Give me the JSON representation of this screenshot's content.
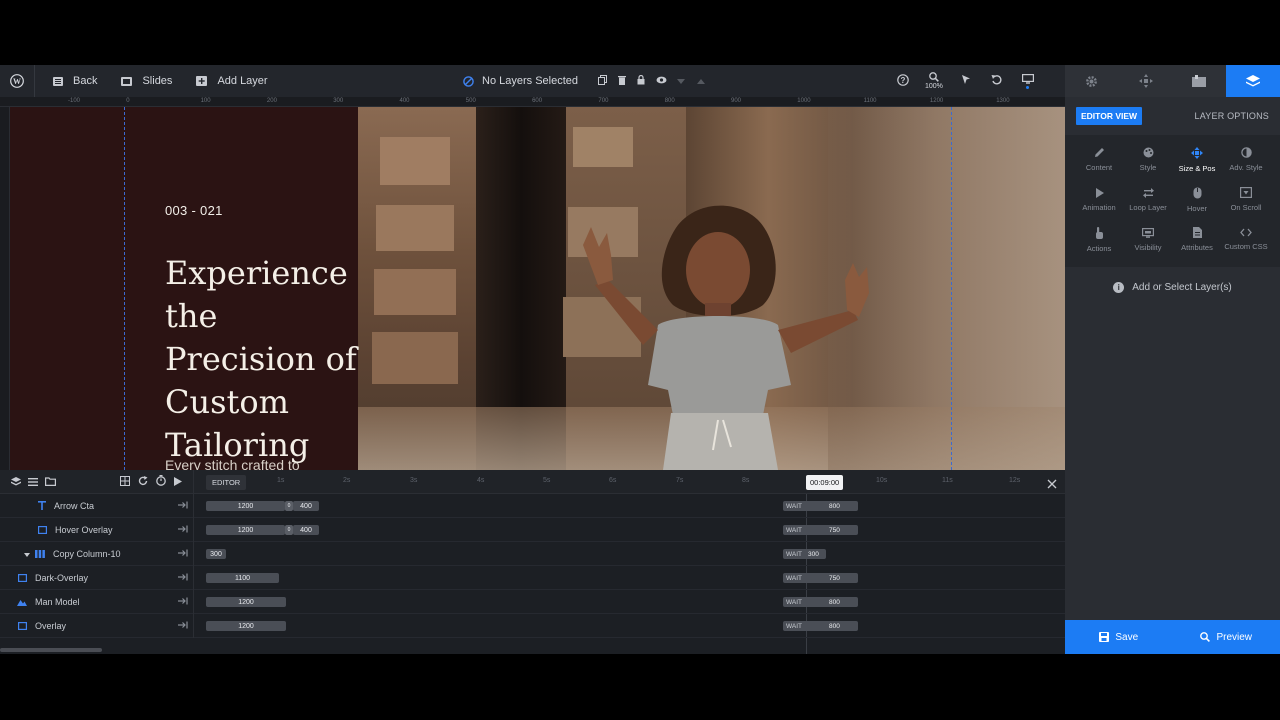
{
  "toolbar": {
    "back_label": "Back",
    "slides_label": "Slides",
    "add_layer_label": "Add Layer",
    "layers_status": "No Layers Selected",
    "zoom": "100%"
  },
  "ruler": {
    "ticks": [
      "-100",
      "0",
      "100",
      "200",
      "300",
      "400",
      "500",
      "600",
      "700",
      "800",
      "900",
      "1000",
      "1100",
      "1200",
      "1300"
    ]
  },
  "slide": {
    "counter": "003 - 021",
    "headline": "Experience the Precision of Custom Tailoring",
    "subtext": "Every stitch crafted to"
  },
  "panel": {
    "editor_view": "EDITOR VIEW",
    "layer_options": "LAYER OPTIONS",
    "options": [
      {
        "label": "Content",
        "icon": "pencil-icon"
      },
      {
        "label": "Style",
        "icon": "palette-icon"
      },
      {
        "label": "Size & Pos",
        "icon": "move-icon"
      },
      {
        "label": "Adv. Style",
        "icon": "contrast-icon"
      },
      {
        "label": "Animation",
        "icon": "play-icon"
      },
      {
        "label": "Loop Layer",
        "icon": "loop-icon"
      },
      {
        "label": "Hover",
        "icon": "mouse-icon"
      },
      {
        "label": "On Scroll",
        "icon": "scroll-icon"
      },
      {
        "label": "Actions",
        "icon": "hand-icon"
      },
      {
        "label": "Visibility",
        "icon": "monitor-icon"
      },
      {
        "label": "Attributes",
        "icon": "file-icon"
      },
      {
        "label": "Custom CSS",
        "icon": "code-icon"
      }
    ],
    "empty_message": "Add or Select Layer(s)",
    "save_label": "Save",
    "preview_label": "Preview"
  },
  "timeline": {
    "editor_label": "EDITOR",
    "current_time": "00:09:00",
    "ticks": [
      "1s",
      "2s",
      "3s",
      "4s",
      "5s",
      "6s",
      "7s",
      "8s",
      "9s",
      "10s",
      "11s",
      "12s"
    ],
    "wait_label": "WAIT",
    "rows": [
      {
        "name": "Arrow Cta",
        "start": "1200",
        "mid": "0",
        "end": "400",
        "wait": "800"
      },
      {
        "name": "Hover Overlay",
        "start": "1200",
        "mid": "0",
        "end": "400",
        "wait": "750"
      },
      {
        "name": "Copy Column-10",
        "start": "300",
        "wait": "300"
      },
      {
        "name": "Dark-Overlay",
        "start": "1100",
        "wait": "750"
      },
      {
        "name": "Man Model",
        "start": "1200",
        "wait": "800"
      },
      {
        "name": "Overlay",
        "start": "1200",
        "wait": "800"
      }
    ]
  }
}
